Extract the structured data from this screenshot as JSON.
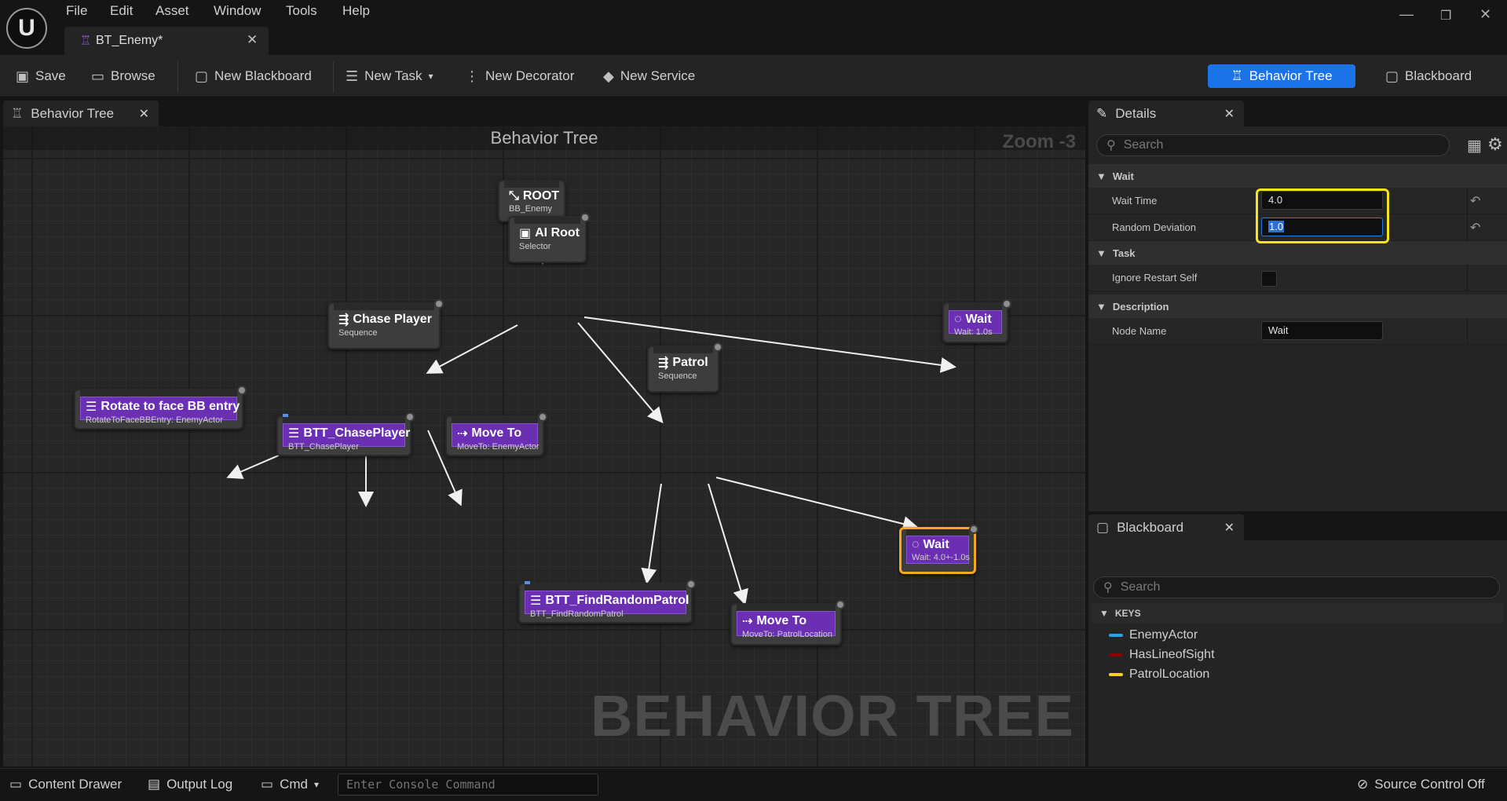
{
  "menu": {
    "file": "File",
    "edit": "Edit",
    "asset": "Asset",
    "window": "Window",
    "tools": "Tools",
    "help": "Help"
  },
  "doc_tab": {
    "label": "BT_Enemy*"
  },
  "toolbar": {
    "save": "Save",
    "browse": "Browse",
    "new_blackboard": "New Blackboard",
    "new_task": "New Task",
    "new_decorator": "New Decorator",
    "new_service": "New Service",
    "mode_behavior_tree": "Behavior Tree",
    "mode_blackboard": "Blackboard"
  },
  "graph": {
    "tab_label": "Behavior Tree",
    "title": "Behavior Tree",
    "zoom": "Zoom -3",
    "watermark": "BEHAVIOR TREE",
    "nodes": {
      "root": {
        "title": "ROOT",
        "sub": "BB_Enemy"
      },
      "ai_root": {
        "title": "AI Root",
        "sub": "Selector"
      },
      "chase_player": {
        "title": "Chase Player",
        "sub": "Sequence"
      },
      "wait_top": {
        "title": "Wait",
        "sub": "Wait: 1.0s"
      },
      "patrol": {
        "title": "Patrol",
        "sub": "Sequence"
      },
      "rotate": {
        "title": "Rotate to face BB entry",
        "sub": "RotateToFaceBBEntry: EnemyActor"
      },
      "btt_chase": {
        "title": "BTT_ChasePlayer",
        "sub": "BTT_ChasePlayer"
      },
      "moveto_enemy": {
        "title": "Move To",
        "sub": "MoveTo: EnemyActor"
      },
      "wait_selected": {
        "title": "Wait",
        "sub": "Wait: 4.0+-1.0s"
      },
      "btt_find": {
        "title": "BTT_FindRandomPatrol",
        "sub": "BTT_FindRandomPatrol"
      },
      "moveto_patrol": {
        "title": "Move To",
        "sub": "MoveTo: PatrolLocation"
      }
    }
  },
  "details": {
    "tab_label": "Details",
    "search_placeholder": "Search",
    "cat_wait": "Wait",
    "wait_time_label": "Wait Time",
    "wait_time_value": "4.0",
    "random_dev_label": "Random Deviation",
    "random_dev_value": "1.0",
    "cat_task": "Task",
    "ignore_restart_label": "Ignore Restart Self",
    "ignore_restart_checked": false,
    "cat_description": "Description",
    "node_name_label": "Node Name",
    "node_name_value": "Wait"
  },
  "blackboard": {
    "tab_label": "Blackboard",
    "search_placeholder": "Search",
    "keys_header": "KEYS",
    "keys": [
      {
        "name": "EnemyActor",
        "color": "#1ea7e8"
      },
      {
        "name": "HasLineofSight",
        "color": "#8b0000"
      },
      {
        "name": "PatrolLocation",
        "color": "#f2d21b"
      }
    ]
  },
  "statusbar": {
    "content_drawer": "Content Drawer",
    "output_log": "Output Log",
    "cmd": "Cmd",
    "console_placeholder": "Enter Console Command",
    "source_control": "Source Control Off"
  },
  "colors": {
    "accent": "#1a73e8",
    "task_purple": "#6b2fb3",
    "selected_outline": "#f5a623",
    "focus_outline": "#f2e51e"
  }
}
